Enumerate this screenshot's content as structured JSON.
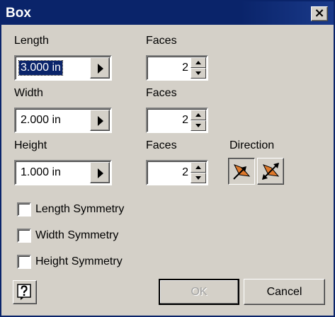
{
  "window": {
    "title": "Box",
    "close_label": "×"
  },
  "length": {
    "label": "Length",
    "value": "3.000 in",
    "faces_label": "Faces",
    "faces": "2"
  },
  "width": {
    "label": "Width",
    "value": "2.000 in",
    "faces_label": "Faces",
    "faces": "2"
  },
  "height": {
    "label": "Height",
    "value": "1.000 in",
    "faces_label": "Faces",
    "faces": "2"
  },
  "direction": {
    "label": "Direction",
    "icons": [
      "direction-flip-icon",
      "direction-symmetric-icon"
    ],
    "accent": "#e07a2c"
  },
  "checkboxes": [
    {
      "label": "Length Symmetry",
      "checked": false
    },
    {
      "label": "Width Symmetry",
      "checked": false
    },
    {
      "label": "Height Symmetry",
      "checked": false
    }
  ],
  "buttons": {
    "ok": "OK",
    "cancel": "Cancel",
    "help_icon": "help-icon"
  },
  "colors": {
    "titlebar": "#0a246a",
    "face": "#d4d0c8"
  }
}
